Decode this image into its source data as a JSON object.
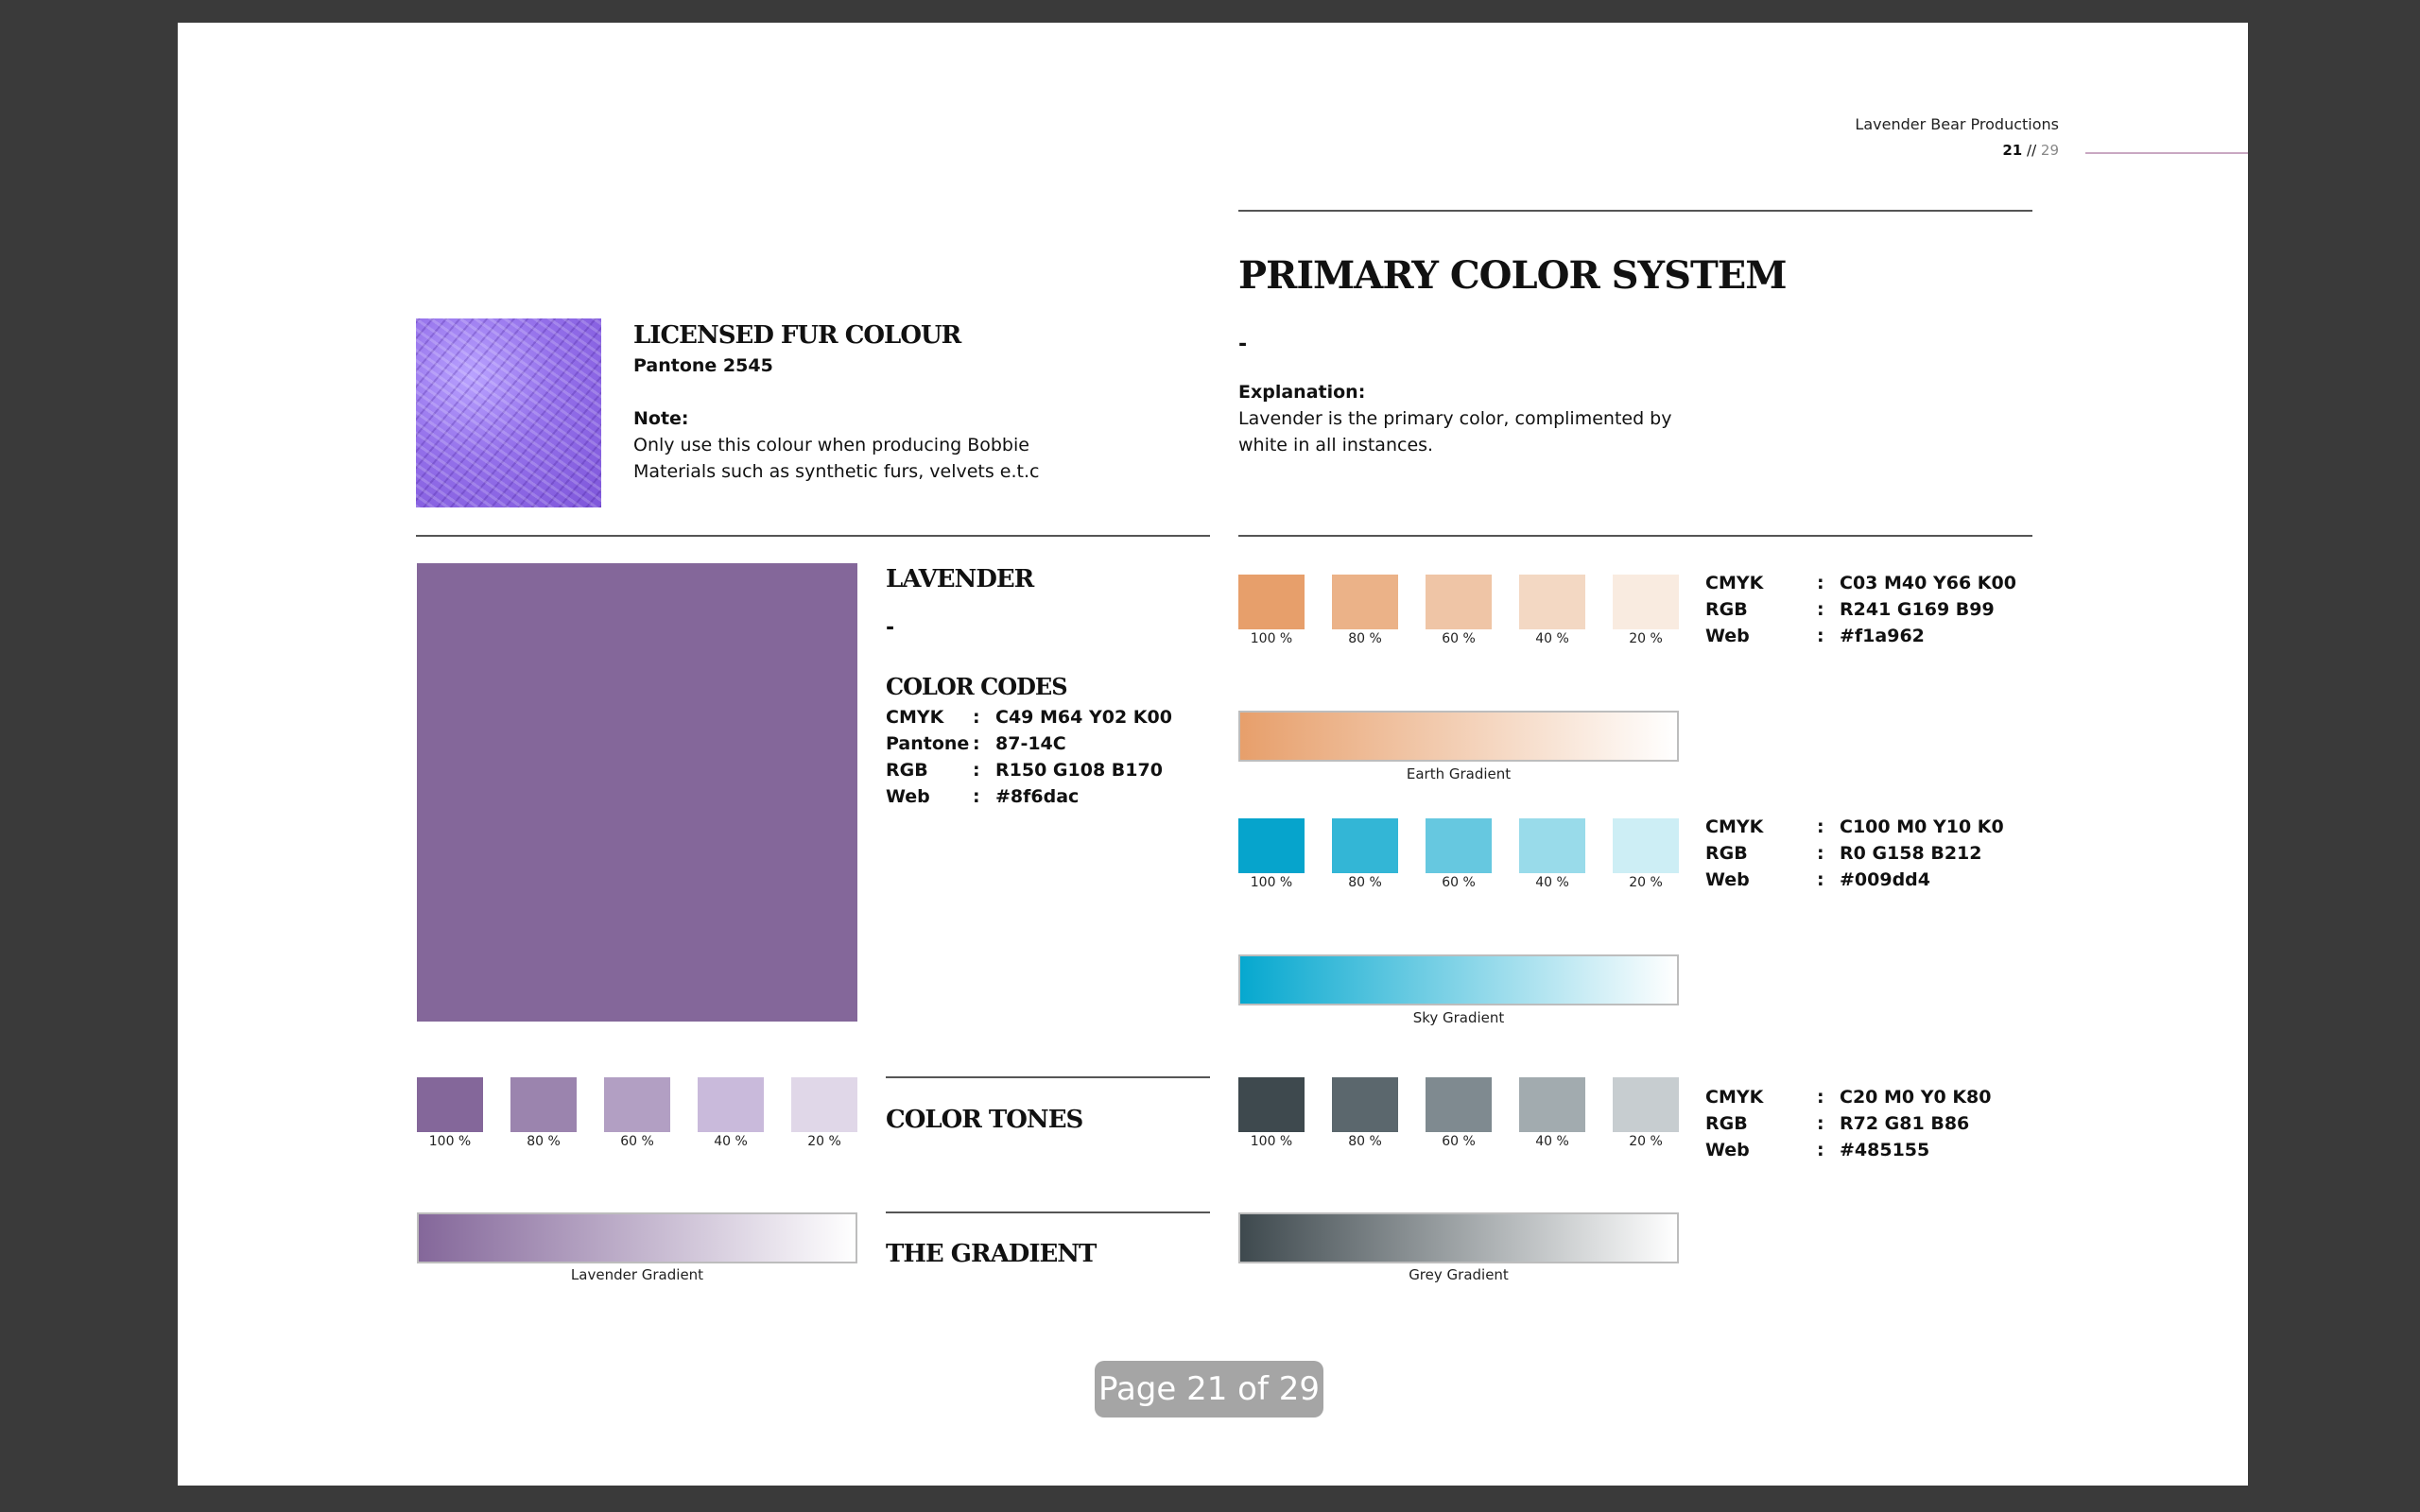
{
  "header": {
    "company": "Lavender Bear Productions",
    "page_current": "21",
    "page_sep": "//",
    "page_total": "29"
  },
  "fur": {
    "title": "Licensed Fur Colour",
    "pantone": "Pantone  2545",
    "note_label": "Note:",
    "note_line1": "Only use this colour when producing Bobbie",
    "note_line2": "Materials such as synthetic furs, velvets e.t.c"
  },
  "primary": {
    "title": "Primary Color System",
    "dash": "-",
    "explanation_label": "Explanation:",
    "explanation_line1": "Lavender is the primary color, complimented by",
    "explanation_line2": "white in all instances."
  },
  "lavender": {
    "title": "Lavender",
    "dash": "-",
    "codes_title": "Color Codes",
    "color": "#84679a",
    "codes": [
      {
        "key": "CMYK",
        "colon": ":",
        "value": "C49   M64   Y02   K00"
      },
      {
        "key": "Pantone",
        "colon": ":",
        "value": "87-14C"
      },
      {
        "key": "RGB",
        "colon": ":",
        "value": "R150 G108 B170"
      },
      {
        "key": "Web",
        "colon": ":",
        "value": "#8f6dac"
      }
    ],
    "tones_title": "Color Tones",
    "gradient_title": "The Gradient",
    "swatches": [
      "#84679a",
      "#9b84ae",
      "#b29fc3",
      "#c9badb",
      "#e0d7e8"
    ],
    "gradient_label": "Lavender Gradient"
  },
  "percents": [
    "100 %",
    "80 %",
    "60 %",
    "40 %",
    "20 %"
  ],
  "earth": {
    "swatches": [
      "#e79f6b",
      "#ebb288",
      "#efc5a6",
      "#f3d8c3",
      "#f9ebe0"
    ],
    "codes": [
      {
        "key": "CMYK",
        "colon": ":",
        "value": "C03   M40   Y66   K00"
      },
      {
        "key": "RGB",
        "colon": ":",
        "value": "R241 G169 B99"
      },
      {
        "key": "Web",
        "colon": ":",
        "value": "#f1a962"
      }
    ],
    "gradient_label": "Earth Gradient",
    "gradient_start": "#e79f6b"
  },
  "sky": {
    "swatches": [
      "#06a4cc",
      "#33b6d6",
      "#66c8e0",
      "#99dbea",
      "#cdeef5"
    ],
    "codes": [
      {
        "key": "CMYK",
        "colon": ":",
        "value": "C100   M0   Y10   K0"
      },
      {
        "key": "RGB",
        "colon": ":",
        "value": "R0 G158 B212"
      },
      {
        "key": "Web",
        "colon": ":",
        "value": "#009dd4"
      }
    ],
    "gradient_label": "Sky Gradient",
    "gradient_start": "#06a8cf"
  },
  "grey": {
    "swatches": [
      "#3e494e",
      "#5b676d",
      "#7f8a90",
      "#a2abaf",
      "#c7cdd0"
    ],
    "codes": [
      {
        "key": "CMYK",
        "colon": ":",
        "value": "C20   M0   Y0   K80"
      },
      {
        "key": "RGB",
        "colon": ":",
        "value": "R72 G81 B86"
      },
      {
        "key": "Web",
        "colon": ":",
        "value": "#485155"
      }
    ],
    "gradient_label": "Grey Gradient",
    "gradient_start": "#3e494e"
  },
  "viewer": {
    "page_indicator": "Page 21 of 29"
  }
}
